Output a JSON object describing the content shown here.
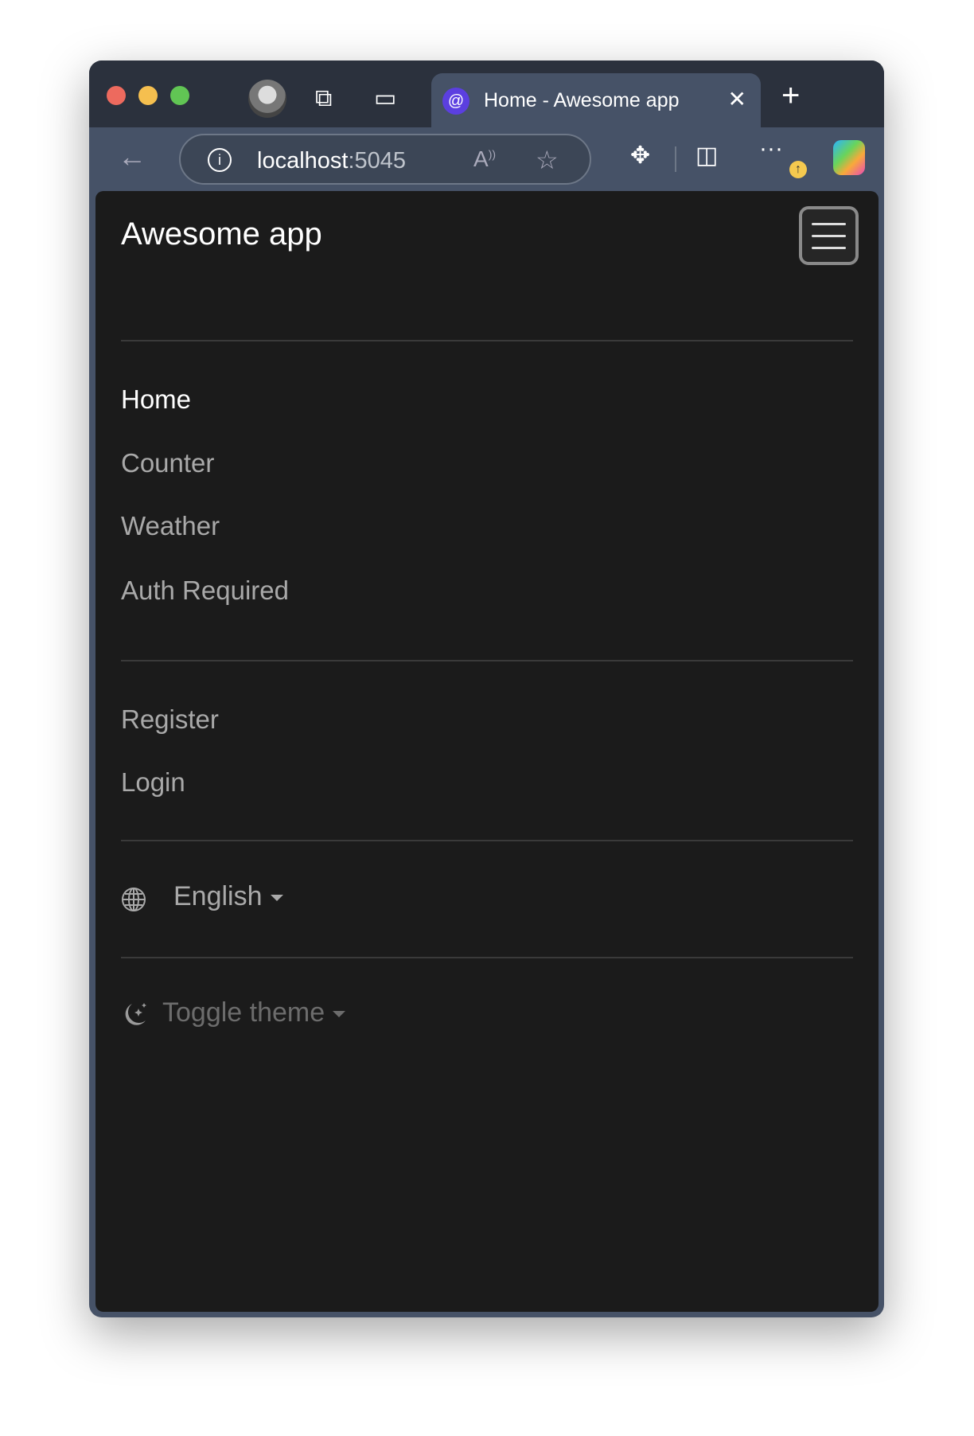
{
  "browser": {
    "traffic_lights": {
      "close": "#ed6a5e",
      "minimize": "#f5bf4f",
      "maximize": "#61c554"
    },
    "tab": {
      "title": "Home - Awesome app",
      "favicon": "blazor-icon"
    },
    "url": {
      "host": "localhost",
      "port": ":5045"
    }
  },
  "app": {
    "brand": "Awesome app",
    "nav": [
      {
        "label": "Home"
      },
      {
        "label": "Counter"
      },
      {
        "label": "Weather"
      },
      {
        "label": "Auth Required"
      }
    ],
    "account": [
      {
        "label": "Register"
      },
      {
        "label": "Login"
      }
    ],
    "language": "English",
    "theme": "Toggle theme"
  }
}
